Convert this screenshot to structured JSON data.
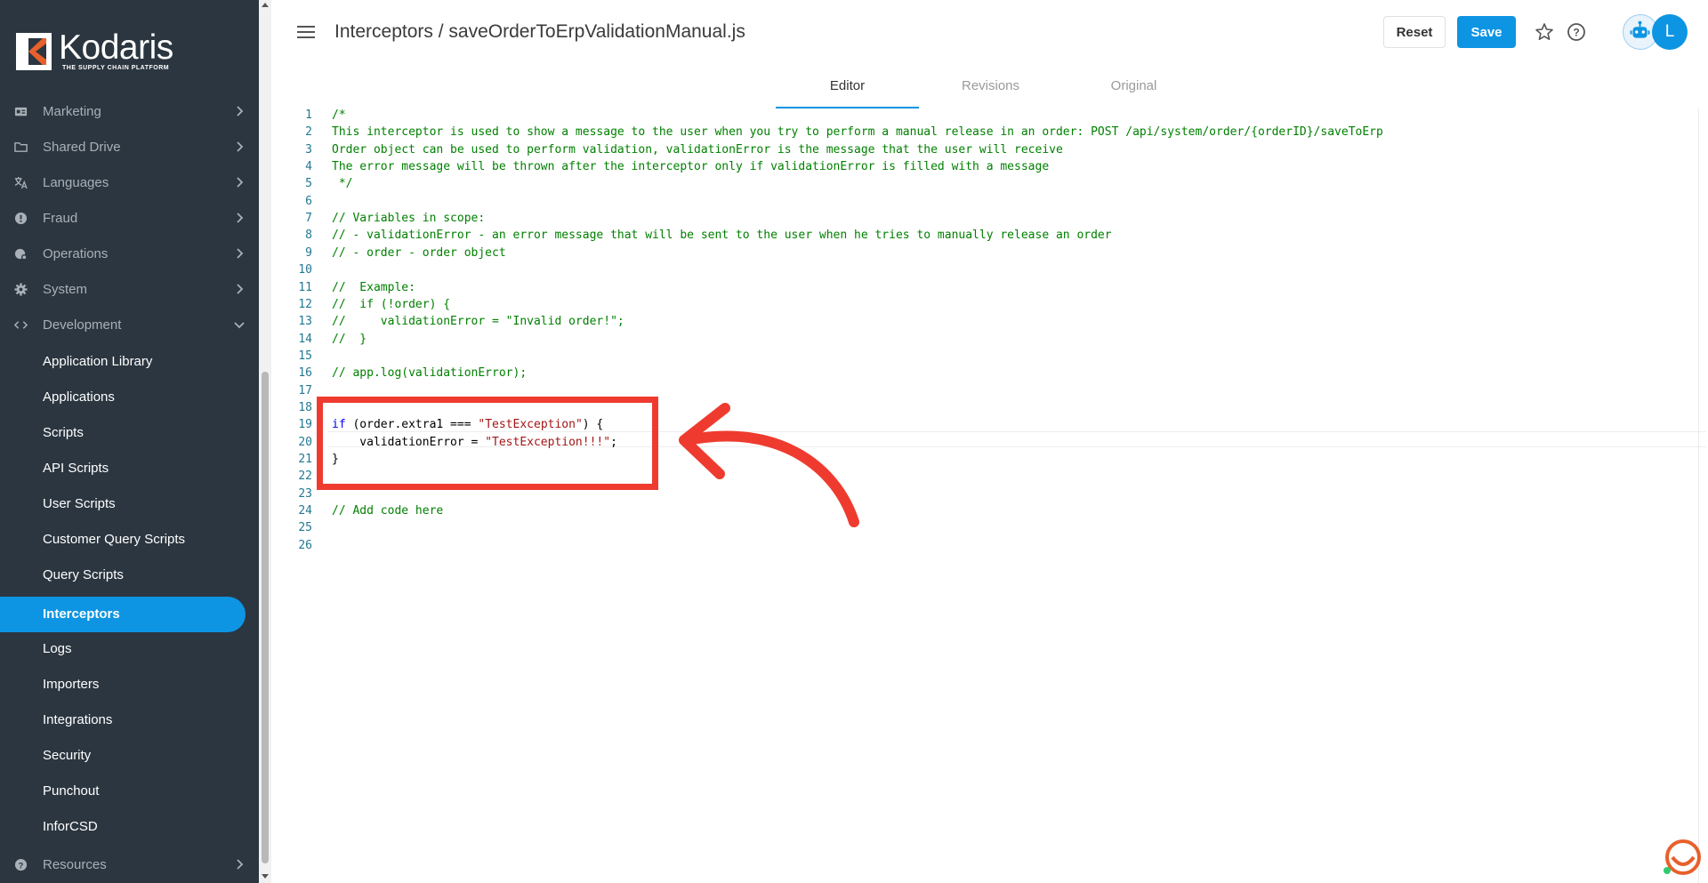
{
  "app": {
    "brand_name": "Kodaris",
    "brand_tagline": "THE SUPPLY CHAIN PLATFORM"
  },
  "sidebar": {
    "items": [
      {
        "label": "Marketing",
        "icon": "marketing-icon"
      },
      {
        "label": "Shared Drive",
        "icon": "folder-icon"
      },
      {
        "label": "Languages",
        "icon": "translate-icon"
      },
      {
        "label": "Fraud",
        "icon": "alert-circle-icon"
      },
      {
        "label": "Operations",
        "icon": "operations-icon"
      },
      {
        "label": "System",
        "icon": "gear-icon"
      },
      {
        "label": "Development",
        "icon": "code-icon",
        "expanded": true
      }
    ],
    "development_children": [
      "Application Library",
      "Applications",
      "Scripts",
      "API Scripts",
      "User Scripts",
      "Customer Query Scripts",
      "Query Scripts",
      "Interceptors",
      "Logs",
      "Importers",
      "Integrations",
      "Security",
      "Punchout",
      "InforCSD"
    ],
    "active_child": "Interceptors",
    "resources": {
      "label": "Resources",
      "icon": "help-circle-icon"
    }
  },
  "header": {
    "title": "Interceptors / saveOrderToErpValidationManual.js",
    "reset_label": "Reset",
    "save_label": "Save",
    "avatar_initial": "L"
  },
  "tabs": [
    {
      "label": "Editor",
      "active": true
    },
    {
      "label": "Revisions",
      "active": false
    },
    {
      "label": "Original",
      "active": false
    }
  ],
  "editor": {
    "lines": [
      "/*",
      "This interceptor is used to show a message to the user when you try to perform a manual release in an order: POST /api/system/order/{orderID}/saveToErp",
      "Order object can be used to perform validation, validationError is the message that the user will receive",
      "The error message will be thrown after the interceptor only if validationError is filled with a message",
      " */",
      "",
      "// Variables in scope:",
      "// - validationError - an error message that will be sent to the user when he tries to manually release an order",
      "// - order - order object",
      "",
      "//  Example:",
      "//  if (!order) {",
      "//     validationError = \"Invalid order!\";",
      "//  }",
      "",
      "// app.log(validationError);",
      "",
      "",
      "if (order.extra1 === \"TestException\") {",
      "    validationError = \"TestException!!!\";",
      "}",
      "",
      "",
      "// Add code here",
      "",
      ""
    ]
  },
  "colors": {
    "sidebar_bg": "#2b3640",
    "accent": "#0d95e3",
    "annotation": "#ef3b2f",
    "comment": "#008000",
    "keyword": "#0000ff",
    "string": "#a31515"
  }
}
